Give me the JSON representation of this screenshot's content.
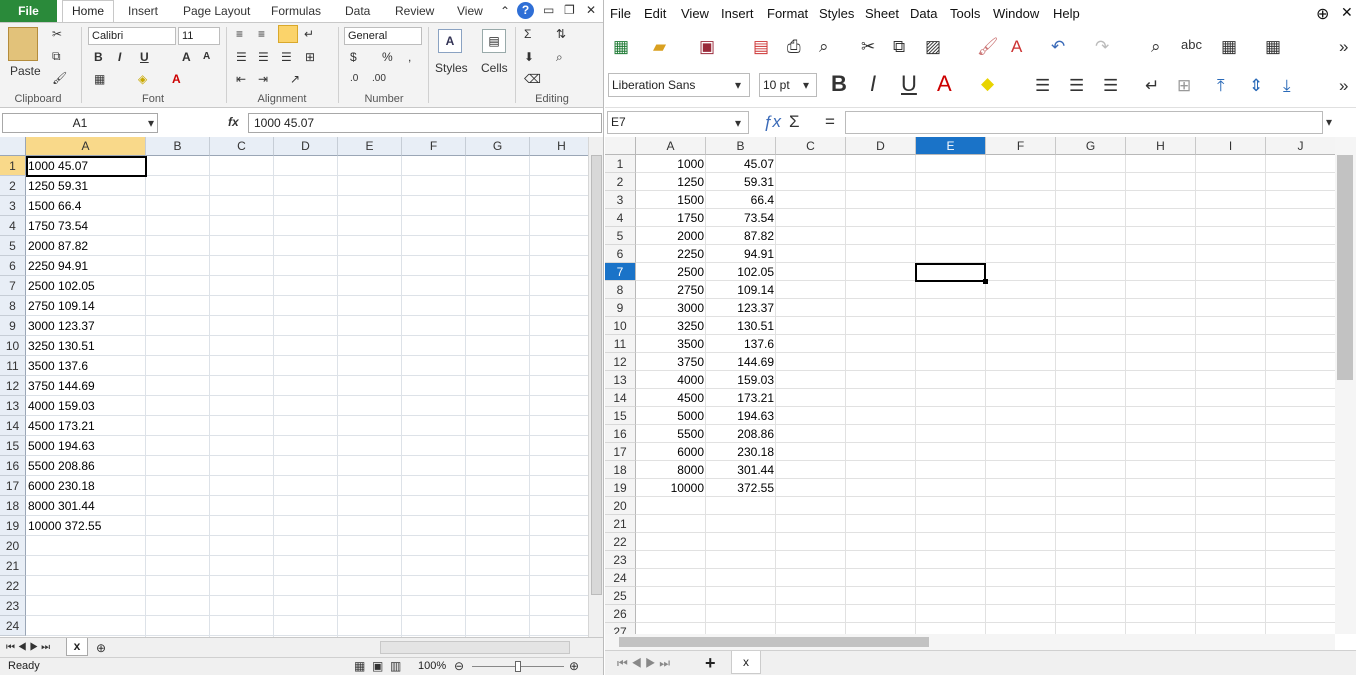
{
  "excel": {
    "ribbon_tabs": [
      "File",
      "Home",
      "Insert",
      "Page Layout",
      "Formulas",
      "Data",
      "Review",
      "View"
    ],
    "clipboard": {
      "paste": "Paste",
      "label": "Clipboard"
    },
    "font": {
      "name": "Calibri",
      "size": "11",
      "label": "Font"
    },
    "alignment": {
      "label": "Alignment"
    },
    "number": {
      "format": "General",
      "label": "Number"
    },
    "styles": {
      "label": "Styles"
    },
    "cells": {
      "label": "Cells"
    },
    "editing": {
      "label": "Editing"
    },
    "name_box": "A1",
    "fx": "fx",
    "formula": "1000 45.07",
    "columns": [
      "A",
      "B",
      "C",
      "D",
      "E",
      "F",
      "G",
      "H"
    ],
    "rows": [
      {
        "n": "1",
        "v": "1000 45.07"
      },
      {
        "n": "2",
        "v": "1250 59.31"
      },
      {
        "n": "3",
        "v": "1500 66.4"
      },
      {
        "n": "4",
        "v": "1750 73.54"
      },
      {
        "n": "5",
        "v": "2000 87.82"
      },
      {
        "n": "6",
        "v": "2250 94.91"
      },
      {
        "n": "7",
        "v": "2500 102.05"
      },
      {
        "n": "8",
        "v": "2750 109.14"
      },
      {
        "n": "9",
        "v": "3000 123.37"
      },
      {
        "n": "10",
        "v": "3250 130.51"
      },
      {
        "n": "11",
        "v": "3500 137.6"
      },
      {
        "n": "12",
        "v": "3750 144.69"
      },
      {
        "n": "13",
        "v": "4000 159.03"
      },
      {
        "n": "14",
        "v": "4500 173.21"
      },
      {
        "n": "15",
        "v": "5000 194.63"
      },
      {
        "n": "16",
        "v": "5500 208.86"
      },
      {
        "n": "17",
        "v": "6000 230.18"
      },
      {
        "n": "18",
        "v": "8000 301.44"
      },
      {
        "n": "19",
        "v": "10000 372.55"
      },
      {
        "n": "20",
        "v": ""
      },
      {
        "n": "21",
        "v": ""
      },
      {
        "n": "22",
        "v": ""
      },
      {
        "n": "23",
        "v": ""
      },
      {
        "n": "24",
        "v": ""
      }
    ],
    "sheet_tab": "x",
    "status": "Ready",
    "zoom": "100%"
  },
  "calc": {
    "menu": [
      "File",
      "Edit",
      "View",
      "Insert",
      "Format",
      "Styles",
      "Sheet",
      "Data",
      "Tools",
      "Window",
      "Help"
    ],
    "font_name": "Liberation Sans",
    "font_size": "10 pt",
    "name_box": "E7",
    "columns": [
      "A",
      "B",
      "C",
      "D",
      "E",
      "F",
      "G",
      "H",
      "I",
      "J"
    ],
    "row_numbers": [
      "1",
      "2",
      "3",
      "4",
      "5",
      "6",
      "7",
      "8",
      "9",
      "10",
      "11",
      "12",
      "13",
      "14",
      "15",
      "16",
      "17",
      "18",
      "19",
      "20",
      "21",
      "22",
      "23",
      "24",
      "25",
      "26",
      "27"
    ],
    "data_a": [
      "1000",
      "1250",
      "1500",
      "1750",
      "2000",
      "2250",
      "2500",
      "2750",
      "3000",
      "3250",
      "3500",
      "3750",
      "4000",
      "4500",
      "5000",
      "5500",
      "6000",
      "8000",
      "10000"
    ],
    "data_b": [
      "45.07",
      "59.31",
      "66.4",
      "73.54",
      "87.82",
      "94.91",
      "102.05",
      "109.14",
      "123.37",
      "130.51",
      "137.6",
      "144.69",
      "159.03",
      "173.21",
      "194.63",
      "208.86",
      "230.18",
      "301.44",
      "372.55"
    ],
    "sheet_tab": "x"
  },
  "colors": {
    "excel_green": "#2a8a3a",
    "calc_select": "#1a73c8"
  }
}
